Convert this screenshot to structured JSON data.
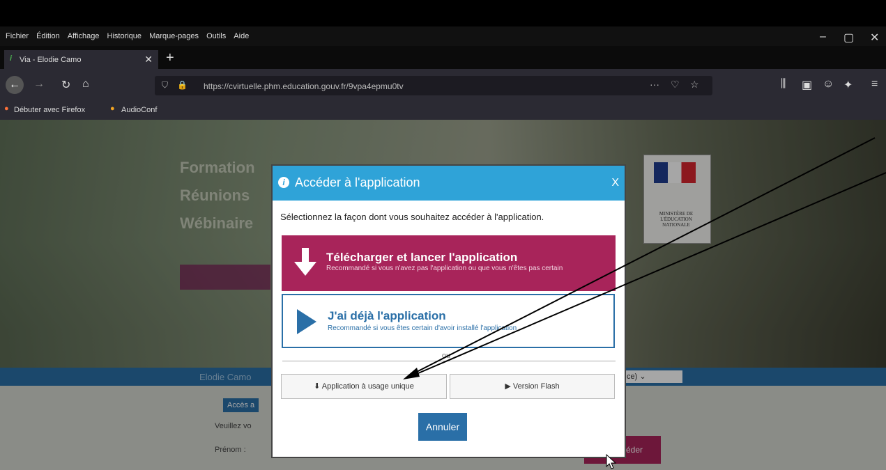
{
  "menubar": {
    "items": [
      "Fichier",
      "Édition",
      "Affichage",
      "Historique",
      "Marque-pages",
      "Outils",
      "Aide"
    ]
  },
  "tab": {
    "title": "Via - Elodie Camo"
  },
  "urlbar": {
    "url": "https://cvirtuelle.phm.education.gouv.fr/9vpa4epmu0tv"
  },
  "bookmarks": {
    "items": [
      "Débuter avec Firefox",
      "AudioConf"
    ]
  },
  "background": {
    "lines": [
      "Formation",
      "Réunions",
      "Wébinaire"
    ],
    "username": "Elodie Camo",
    "form_fields": [
      "Veuillez vo",
      "Prénom :"
    ],
    "side_button": "éder",
    "badge": "Accès a",
    "ministry": "MINISTÈRE DE L'ÉDUCATION NATIONALE"
  },
  "modal": {
    "title": "Accéder à l'application",
    "close": "X",
    "instruction": "Sélectionnez la façon dont vous souhaitez accéder à l'application.",
    "download_title": "Télécharger et lancer l'application",
    "download_sub": "Recommandé si vous n'avez pas l'application ou que vous n'êtes pas certain",
    "have_title": "J'ai déjà l'application",
    "have_sub": "Recommandé si vous êtes certain d'avoir installé l'application",
    "or": "ou",
    "unique_button": "Application à usage unique",
    "flash_button": "Version Flash",
    "cancel_button": "Annuler"
  },
  "colors": {
    "header": "#2fa3d8",
    "download_bg": "#a8245a",
    "accent_blue": "#2a6fa7"
  }
}
